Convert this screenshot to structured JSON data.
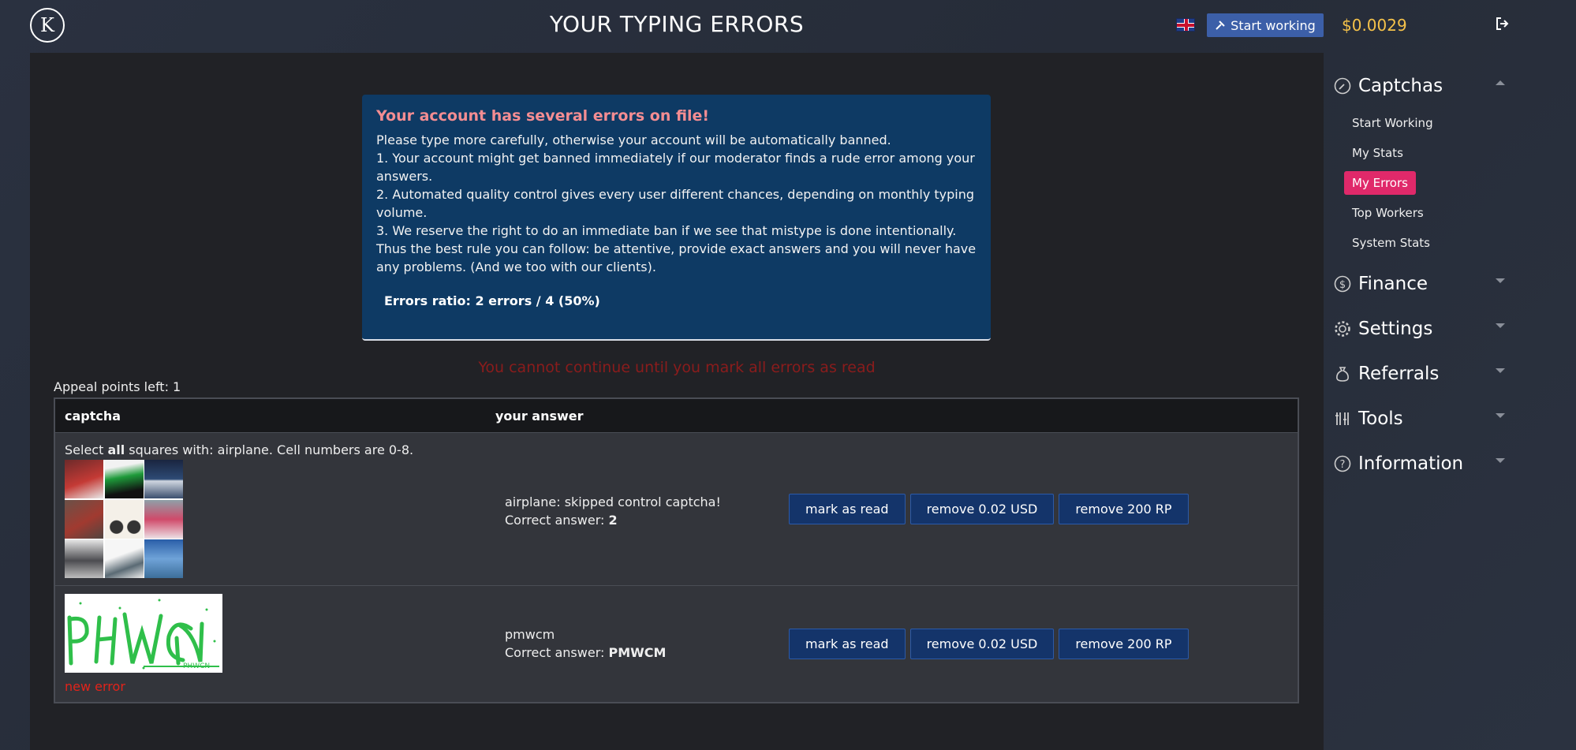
{
  "header": {
    "logo_glyph": "K",
    "title": "YOUR TYPING ERRORS",
    "language_flag": "uk-flag-icon",
    "start_button_label": "Start working",
    "balance": "$0.0029"
  },
  "notice": {
    "heading": "Your account has several errors on file!",
    "line1": "Please type more carefully, otherwise your account will be automatically banned.",
    "line2": "1. Your account might get banned immediately if our moderator finds a rude error among your answers.",
    "line3": "2. Automated quality control gives every user different chances, depending on monthly typing volume.",
    "line4": "3. We reserve the right to do an immediate ban if we see that mistype is done intentionally.",
    "line5": "Thus the best rule you can follow: be attentive, provide exact answers and you will never have any problems. (And we too with our clients).",
    "errors_ratio": "Errors ratio: 2 errors / 4 (50%)"
  },
  "blocked_message": "You cannot continue until you mark all errors as read",
  "appeal_points": "Appeal points left: 1",
  "table": {
    "headers": [
      "captcha",
      "your answer"
    ],
    "rows": [
      {
        "captcha_prefix": "Select ",
        "captcha_bold": "all",
        "captcha_suffix": " squares with: airplane. Cell numbers are 0-8.",
        "answer": "airplane: skipped control captcha!",
        "correct_label": "Correct answer: ",
        "correct_value": "2",
        "actions": [
          "mark as read",
          "remove 0.02 USD",
          "remove 200 RP"
        ]
      },
      {
        "captcha_image_text": "PHWCN",
        "new_error": "new error",
        "answer": "pmwcm",
        "correct_label": "Correct answer: ",
        "correct_value": "PMWCM",
        "actions": [
          "mark as read",
          "remove 0.02 USD",
          "remove 200 RP"
        ]
      }
    ]
  },
  "sidebar": {
    "sections": [
      {
        "label": "Captchas",
        "icon": "compass-icon",
        "expanded": true,
        "items": [
          "Start Working",
          "My Stats",
          "My Errors",
          "Top Workers",
          "System Stats"
        ],
        "active": "My Errors"
      },
      {
        "label": "Finance",
        "icon": "dollar-icon"
      },
      {
        "label": "Settings",
        "icon": "gear-icon"
      },
      {
        "label": "Referrals",
        "icon": "moneybag-icon"
      },
      {
        "label": "Tools",
        "icon": "tools-icon"
      },
      {
        "label": "Information",
        "icon": "question-icon"
      }
    ]
  },
  "colors": {
    "accent_active": "#e0296a",
    "balance": "#f5c24a",
    "notice_bg": "#0e3a64",
    "button_bg": "#14346a",
    "error_red": "#e2231a"
  }
}
